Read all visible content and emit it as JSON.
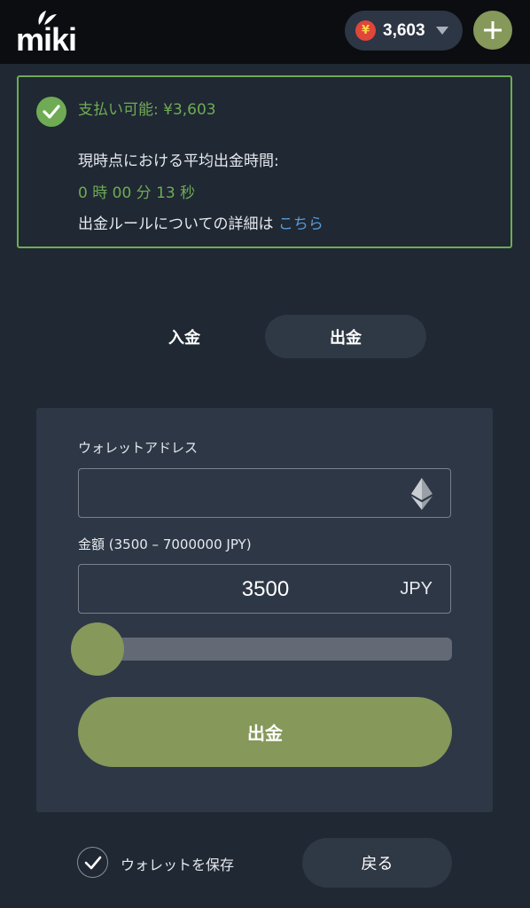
{
  "header": {
    "logo_text": "miki",
    "balance": "3,603",
    "currency_symbol": "¥"
  },
  "info": {
    "available_label": "支払い可能: ¥3,603",
    "avg_time_label": "現時点における平均出金時間:",
    "avg_time_value": "0 時 00 分 13 秒",
    "rules_text": "出金ルールについての詳細は",
    "rules_link": "こちら"
  },
  "tabs": [
    {
      "label": "入金",
      "active": false
    },
    {
      "label": "出金",
      "active": true
    }
  ],
  "form": {
    "wallet_label": "ウォレットアドレス",
    "wallet_value": "",
    "amount_label": "金額 (3500 – 7000000 JPY)",
    "amount_value": "3500",
    "amount_unit": "JPY",
    "slider_level": 0,
    "submit_label": "出金"
  },
  "footer": {
    "save_wallet_label": "ウォレットを保存",
    "save_wallet_checked": true,
    "back_label": "戻る"
  },
  "colors": {
    "background": "#1f2833",
    "accent_green": "#86985a",
    "success_green": "#6fab54",
    "link_blue": "#5a9bd8"
  },
  "icons": [
    "miki-leaf-logo",
    "yen-coin-icon",
    "caret-down-icon",
    "plus-icon",
    "check-icon",
    "ethereum-icon"
  ]
}
